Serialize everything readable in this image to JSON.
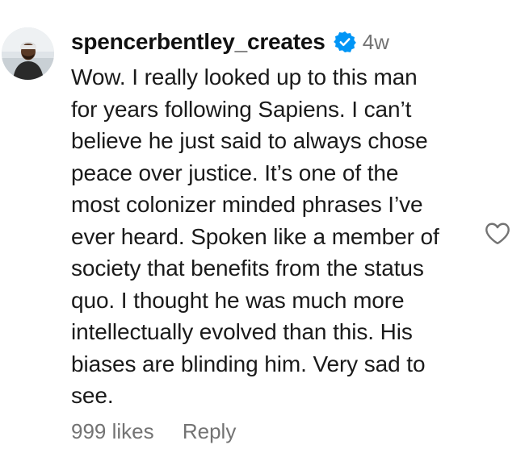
{
  "comment": {
    "username": "spencerbentley_creates",
    "verified_icon": "verified-badge-icon",
    "timestamp": "4w",
    "text_lines": [
      "Wow. I really looked up to this man",
      "for years following Sapiens. I can’t",
      "believe he just said to always chose",
      "peace over justice. It’s one of the",
      "most colonizer minded phrases I’ve",
      "ever heard. Spoken like a member of",
      "society that benefits from the status",
      "quo. I thought he was much more",
      "intellectually evolved than this. His",
      "biases are blinding him. Very sad to",
      "see."
    ],
    "like_icon": "heart-outline-icon",
    "likes_label": "999 likes",
    "reply_label": "Reply"
  },
  "colors": {
    "verified_blue": "#0095f6",
    "secondary_text": "#737373",
    "primary_text": "#1a1a1a"
  }
}
